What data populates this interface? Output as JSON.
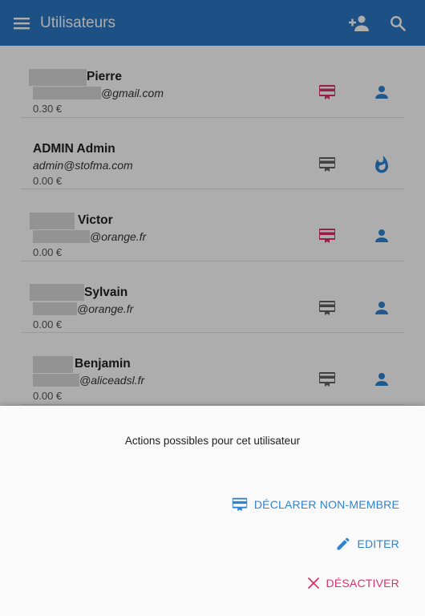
{
  "app_bar": {
    "title": "Utilisateurs",
    "icons": [
      "menu-icon",
      "add-person-icon",
      "search-icon"
    ],
    "color": "#2b78c6"
  },
  "users": [
    {
      "name": "Pierre",
      "email": "@gmail.com",
      "balance": "0.30 €",
      "card_icon": "card-membership-icon",
      "card_color": "#e0306a",
      "status_icon": "person-icon"
    },
    {
      "name": "ADMIN Admin",
      "email": "admin@stofma.com",
      "balance": "0.00 €",
      "card_icon": "card-membership-icon",
      "card_color": "#616161",
      "status_icon": "flame-icon"
    },
    {
      "name": "Victor",
      "email": "@orange.fr",
      "balance": "0.00 €",
      "card_icon": "card-membership-icon",
      "card_color": "#e0306a",
      "status_icon": "person-icon"
    },
    {
      "name": "Sylvain",
      "email": "@orange.fr",
      "balance": "0.00 €",
      "card_icon": "card-membership-icon",
      "card_color": "#616161",
      "status_icon": "person-icon"
    },
    {
      "name": "Benjamin",
      "email": "@aliceadsl.fr",
      "balance": "0.00 €",
      "card_icon": "card-membership-icon",
      "card_color": "#616161",
      "status_icon": "person-icon"
    }
  ],
  "bottom_sheet": {
    "title": "Actions possibles pour cet utilisateur",
    "actions": [
      {
        "label": "DÉCLARER NON-MEMBRE",
        "icon": "card-membership-icon",
        "color": "#2f83d0"
      },
      {
        "label": "EDITER",
        "icon": "pencil-icon",
        "color": "#2f83d0"
      },
      {
        "label": "DÉSACTIVER",
        "icon": "close-icon",
        "color": "#e0306a"
      }
    ]
  }
}
